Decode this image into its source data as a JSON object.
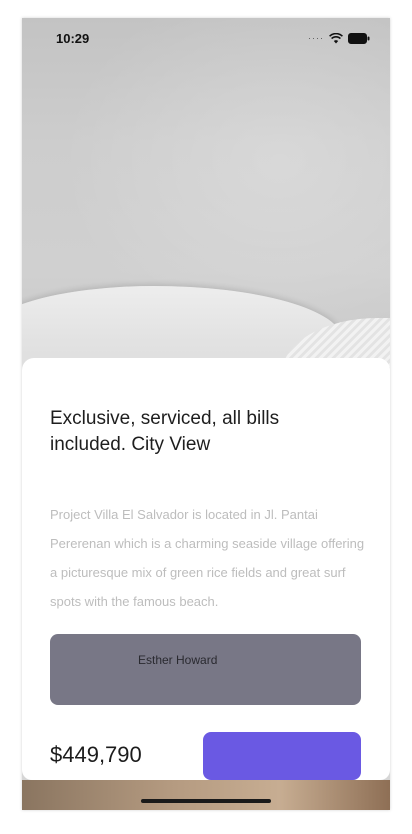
{
  "status_bar": {
    "time": "10:29",
    "signal_icon": "signal-dots-icon",
    "wifi_icon": "wifi-icon",
    "battery_icon": "battery-icon"
  },
  "listing": {
    "hero_image": "bedroom-pillow-photo",
    "title": "Exclusive, serviced, all bills included. City View",
    "description": "Project Villa El Salvador is located in Jl. Pantai Pererenan which is a charming seaside village offering a picturesque mix of green rice fields and great surf spots with the famous beach.",
    "agent_name": "Esther Howard",
    "price": "$449,790",
    "book_button_label": ""
  },
  "colors": {
    "accent": "#6a59e3",
    "agent_box": "#787786",
    "description_text": "#bdbdbd"
  }
}
